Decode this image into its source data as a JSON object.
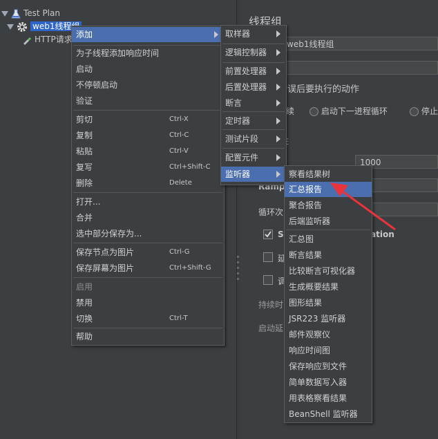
{
  "tree": {
    "items": [
      {
        "label": "Test Plan"
      },
      {
        "label": "web1线程组"
      },
      {
        "label": "HTTP请求"
      }
    ]
  },
  "right": {
    "title": "线程组",
    "name_value": "web1线程组",
    "on_error_label": "错误后要执行的动作",
    "radio_continue": "续",
    "radio_next_loop": "启动下一进程循环",
    "radio_stop": "停止",
    "props_label": "性",
    "threads_value": "1000",
    "ramp_label": "Ramp-",
    "loop_label": "循环次",
    "checkbox_same_user": "Sa",
    "checkbox_same_user_tail": "ation",
    "delay_label": "延",
    "scheduler_label": "调",
    "duration_label": "持续时",
    "startup_delay_label": "启动延"
  },
  "context_menu": {
    "add": "添加",
    "add_think_time": "为子线程添加响应时间",
    "start": "启动",
    "start_no_pause": "不停顿启动",
    "validate": "验证",
    "cut": "剪切",
    "cut_key": "Ctrl-X",
    "copy": "复制",
    "copy_key": "Ctrl-C",
    "paste": "粘贴",
    "paste_key": "Ctrl-V",
    "duplicate": "复写",
    "duplicate_key": "Ctrl+Shift-C",
    "remove": "删除",
    "remove_key": "Delete",
    "open": "打开...",
    "merge": "合并",
    "save_selection": "选中部分保存为...",
    "save_node_image": "保存节点为图片",
    "save_node_image_key": "Ctrl-G",
    "save_screen_image": "保存屏幕为图片",
    "save_screen_image_key": "Ctrl+Shift-G",
    "enable": "启用",
    "disable": "禁用",
    "toggle": "切换",
    "toggle_key": "Ctrl-T",
    "help": "帮助"
  },
  "add_submenu": {
    "items": [
      "取样器",
      "逻辑控制器",
      "前置处理器",
      "后置处理器",
      "断言",
      "定时器",
      "测试片段",
      "配置元件",
      "监听器"
    ]
  },
  "listener_submenu": {
    "items": [
      "察看结果树",
      "汇总报告",
      "聚合报告",
      "后端监听器",
      "汇总图",
      "断言结果",
      "比较断言可视化器",
      "生成概要结果",
      "图形结果",
      "JSR223 监听器",
      "邮件观察仪",
      "响应时间图",
      "保存响应到文件",
      "简单数据写入器",
      "用表格察看结果",
      "BeanShell 监听器"
    ]
  },
  "colors": {
    "highlight": "#4b6eaf",
    "arrow": "#e8343a"
  }
}
